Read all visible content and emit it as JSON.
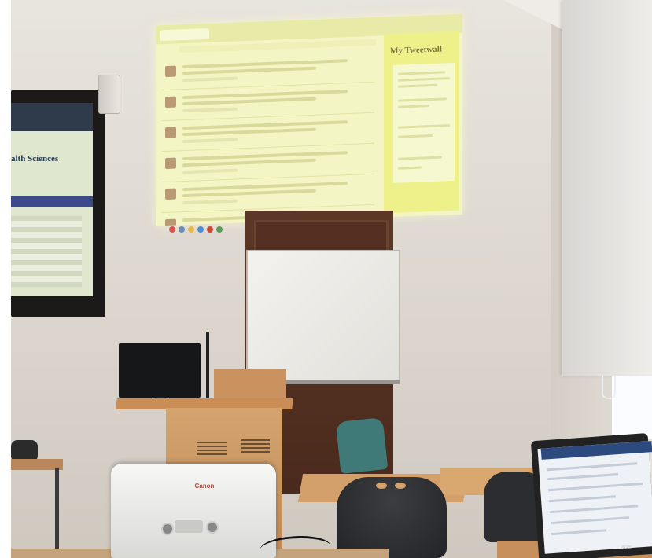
{
  "projection": {
    "sidebar_title": "My Tweetwall",
    "tweet_count": 6,
    "taskbar_icons": [
      "chrome-icon",
      "files-icon",
      "gmail-icon",
      "docs-icon",
      "youtube-icon",
      "play-icon"
    ]
  },
  "tv": {
    "heading": "alth Sciences"
  },
  "projector": {
    "brand": "Canon"
  },
  "laptop": {
    "brand": "acer"
  },
  "colors": {
    "projection_bg": "#f3f6c4",
    "projection_sidebar": "#eef08a",
    "door": "#4a2a1d",
    "lectern": "#c98d55",
    "chair_teal": "#3f7a78"
  }
}
